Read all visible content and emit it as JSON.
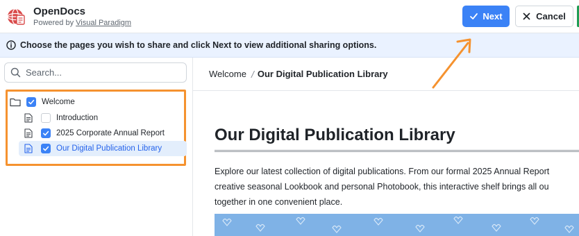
{
  "header": {
    "app_title": "OpenDocs",
    "powered_prefix": "Powered by",
    "powered_link": "Visual Paradigm",
    "next_label": "Next",
    "cancel_label": "Cancel"
  },
  "info_bar": {
    "text": "Choose the pages you wish to share and click Next to view additional sharing options."
  },
  "sidebar": {
    "search_placeholder": "Search...",
    "tree": [
      {
        "label": "Welcome",
        "type": "folder",
        "checked": true,
        "selected": false
      },
      {
        "label": "Introduction",
        "type": "page",
        "checked": false,
        "selected": false
      },
      {
        "label": "2025 Corporate Annual Report",
        "type": "page",
        "checked": true,
        "selected": false
      },
      {
        "label": "Our Digital Publication Library",
        "type": "page",
        "checked": true,
        "selected": true
      }
    ]
  },
  "breadcrumb": {
    "parent": "Welcome",
    "separator": "/",
    "current": "Our Digital Publication Library"
  },
  "document": {
    "title": "Our Digital Publication Library",
    "body_lines": [
      "Explore our latest collection of digital publications. From our formal 2025 Annual Report",
      "creative seasonal Lookbook and personal Photobook, this interactive shelf brings all ou",
      "together in one convenient place."
    ]
  },
  "colors": {
    "accent": "#3b82f6",
    "highlight_border": "#f5922f",
    "info_bg": "#eaf2ff",
    "selected_bg": "#e3eefc"
  },
  "icons": [
    "opendocs-logo-icon",
    "check-icon",
    "close-icon",
    "info-icon",
    "search-icon",
    "folder-icon",
    "page-icon",
    "annotation-arrow"
  ]
}
